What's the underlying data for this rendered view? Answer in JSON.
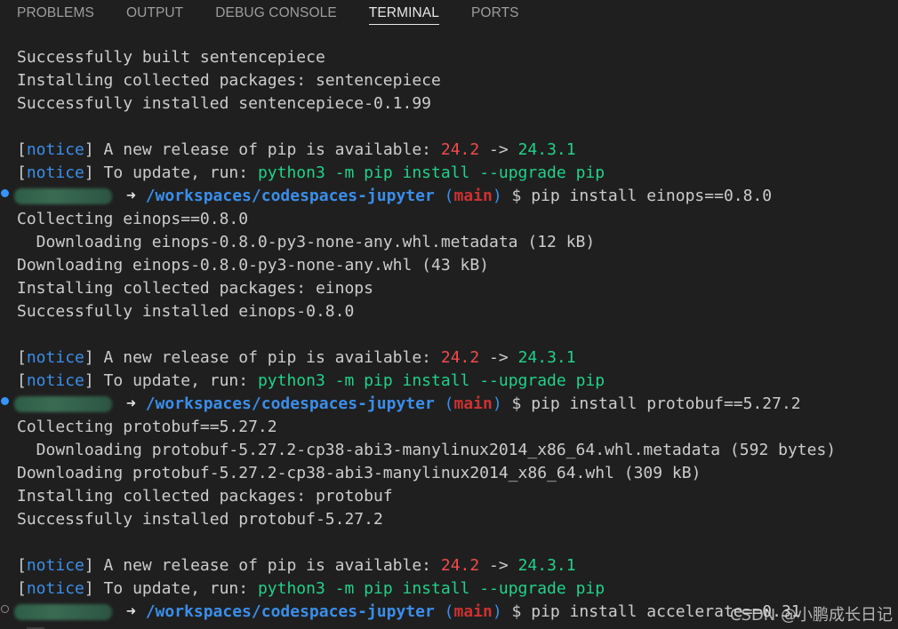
{
  "panel": {
    "tabs": [
      {
        "label": "PROBLEMS"
      },
      {
        "label": "OUTPUT"
      },
      {
        "label": "DEBUG CONSOLE"
      },
      {
        "label": "TERMINAL"
      },
      {
        "label": "PORTS"
      }
    ],
    "active_tab": "TERMINAL"
  },
  "terminal": {
    "block1": {
      "l1": "Successfully built sentencepiece",
      "l2": "Installing collected packages: sentencepiece",
      "l3": "Successfully installed sentencepiece-0.1.99"
    },
    "notice1": {
      "tag": "notice",
      "release_text": " A new release of pip is available: ",
      "old_version": "24.2",
      "arrow": " -> ",
      "new_version": "24.3.1",
      "update_text": " To update, run: ",
      "update_cmd": "python3 -m pip install --upgrade pip"
    },
    "prompt1": {
      "path": "/workspaces/codespaces-jupyter",
      "branch": "main",
      "command": "pip install einops==0.8.0"
    },
    "block2": {
      "l1": "Collecting einops==0.8.0",
      "l2": "  Downloading einops-0.8.0-py3-none-any.whl.metadata (12 kB)",
      "l3": "Downloading einops-0.8.0-py3-none-any.whl (43 kB)",
      "l4": "Installing collected packages: einops",
      "l5": "Successfully installed einops-0.8.0"
    },
    "prompt2": {
      "path": "/workspaces/codespaces-jupyter",
      "branch": "main",
      "command": "pip install protobuf==5.27.2"
    },
    "block3": {
      "l1": "Collecting protobuf==5.27.2",
      "l2": "  Downloading protobuf-5.27.2-cp38-abi3-manylinux2014_x86_64.whl.metadata (592 bytes)",
      "l3": "Downloading protobuf-5.27.2-cp38-abi3-manylinux2014_x86_64.whl (309 kB)",
      "l4": "Installing collected packages: protobuf",
      "l5": "Successfully installed protobuf-5.27.2"
    },
    "prompt3": {
      "path": "/workspaces/codespaces-jupyter",
      "branch": "main",
      "command": "pip install accelerate==0.31"
    }
  },
  "watermark": "CSDN @小鹏成长日记",
  "colors": {
    "background": "#1f1f1f",
    "notice_blue": "#3b8eea",
    "version_red": "#f14c4c",
    "version_green": "#23d18b",
    "branch_red": "#cd3131",
    "text": "#cccccc"
  },
  "icons": {
    "prompt_arrow": "arrow-right-icon",
    "command_status": "command-status-dot-icon"
  }
}
